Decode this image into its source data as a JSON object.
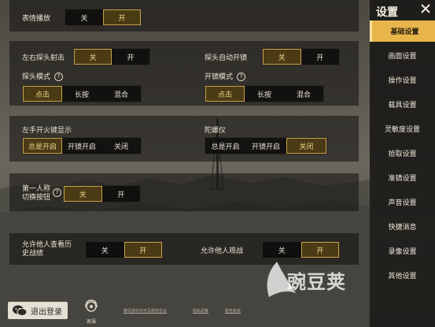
{
  "colors": {
    "accent": "#e8b54b",
    "selected_text": "#f2d58b",
    "selected_border": "#c9a24a"
  },
  "top": {
    "label": "表情播放",
    "options": [
      "关",
      "开"
    ],
    "selected": 1
  },
  "sec1": {
    "left_label": "左右探头射击",
    "left_options": [
      "关",
      "开"
    ],
    "left_selected": 0,
    "right_label": "探头自动开镜",
    "right_options": [
      "关",
      "开"
    ],
    "right_selected": 0,
    "mode_left_label": "探头模式",
    "mode_left_options": [
      "点击",
      "长按",
      "混合"
    ],
    "mode_left_selected": 0,
    "mode_right_label": "开镜模式",
    "mode_right_options": [
      "点击",
      "长按",
      "混合"
    ],
    "mode_right_selected": 0
  },
  "sec2": {
    "left_label": "左手开火键显示",
    "left_options": [
      "总是开启",
      "开镜开启",
      "关闭"
    ],
    "left_selected": 0,
    "right_label": "陀螺仪",
    "right_options": [
      "总是开启",
      "开镜开启",
      "关闭"
    ],
    "right_selected": 2
  },
  "sec3": {
    "label_line1": "第一人称",
    "label_line2": "切换按钮",
    "options": [
      "关",
      "开"
    ],
    "selected": 0
  },
  "sec4": {
    "left_line1": "允许他人查看历",
    "left_line2": "史战绩",
    "left_options": [
      "关",
      "开"
    ],
    "left_selected": 1,
    "right_label": "允许他人观战",
    "right_options": [
      "关",
      "开"
    ],
    "right_selected": 1
  },
  "help_glyph": "?",
  "sidebar": {
    "title": "设置",
    "close_icon": "close-icon",
    "items": [
      {
        "label": "基础设置",
        "active": true
      },
      {
        "label": "画面设置"
      },
      {
        "label": "操作设置"
      },
      {
        "label": "载具设置"
      },
      {
        "label": "灵敏度设置"
      },
      {
        "label": "拾取设置"
      },
      {
        "label": "准镜设置"
      },
      {
        "label": "声音设置"
      },
      {
        "label": "快捷消息"
      },
      {
        "label": "录像设置"
      },
      {
        "label": "其他设置"
      }
    ]
  },
  "footer": {
    "logout_label": "退出登录",
    "support_label": "客服",
    "link1": "腾讯游戏许可及服务协议",
    "link2": "隐私政策",
    "link3": "服务条款"
  },
  "watermark": "豌豆荚"
}
